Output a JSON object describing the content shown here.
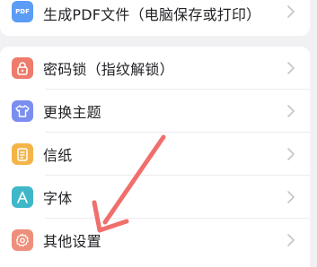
{
  "top_item": {
    "icon": "pdf-icon",
    "icon_text": "PDF",
    "icon_color": "#5b9cf5",
    "label": "生成PDF文件（电脑保存或打印）"
  },
  "items": [
    {
      "icon": "lock-icon",
      "color": "#ee7b6b",
      "label": "密码锁（指纹解锁）"
    },
    {
      "icon": "shirt-icon",
      "color": "#7b8ef0",
      "label": "更换主题"
    },
    {
      "icon": "note-paper-icon",
      "color": "#f3b548",
      "label": "信纸"
    },
    {
      "icon": "font-a-icon",
      "color": "#3eb8c9",
      "label": "字体"
    },
    {
      "icon": "settings-gear-icon",
      "color": "#ee8f7c",
      "label": "其他设置"
    }
  ],
  "annotation": {
    "arrow_color": "#f06f6c"
  }
}
